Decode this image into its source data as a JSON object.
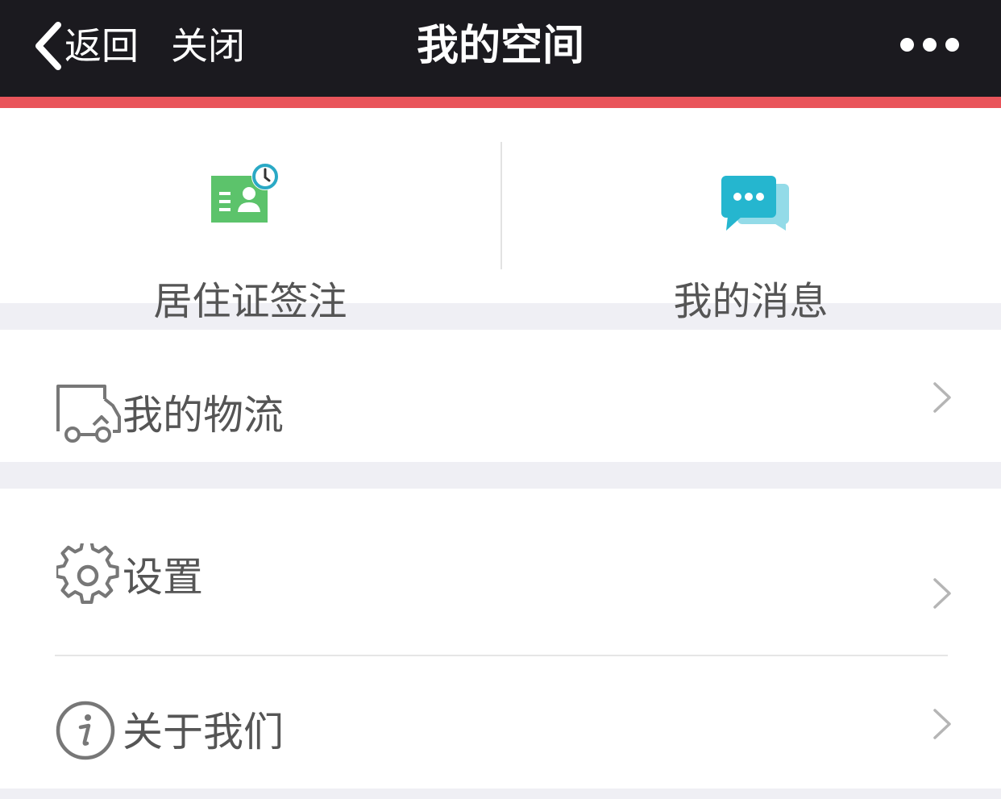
{
  "nav": {
    "back_label": "返回",
    "close_label": "关闭",
    "title": "我的空间",
    "more_icon": "more-dots-icon"
  },
  "quick": [
    {
      "label": "居住证签注",
      "icon": "id-card-clock-icon"
    },
    {
      "label": "我的消息",
      "icon": "chat-bubbles-icon"
    }
  ],
  "list": [
    {
      "label": "我的物流",
      "icon": "truck-icon"
    },
    {
      "label": "设置",
      "icon": "gear-icon"
    },
    {
      "label": "关于我们",
      "icon": "info-icon"
    }
  ],
  "colors": {
    "navbar": "#1b1a1f",
    "accent_bar": "#e9545a",
    "id_card_green": "#5cc36b",
    "message_teal": "#25b6cf",
    "background": "#efeff4",
    "text": "#555555"
  }
}
